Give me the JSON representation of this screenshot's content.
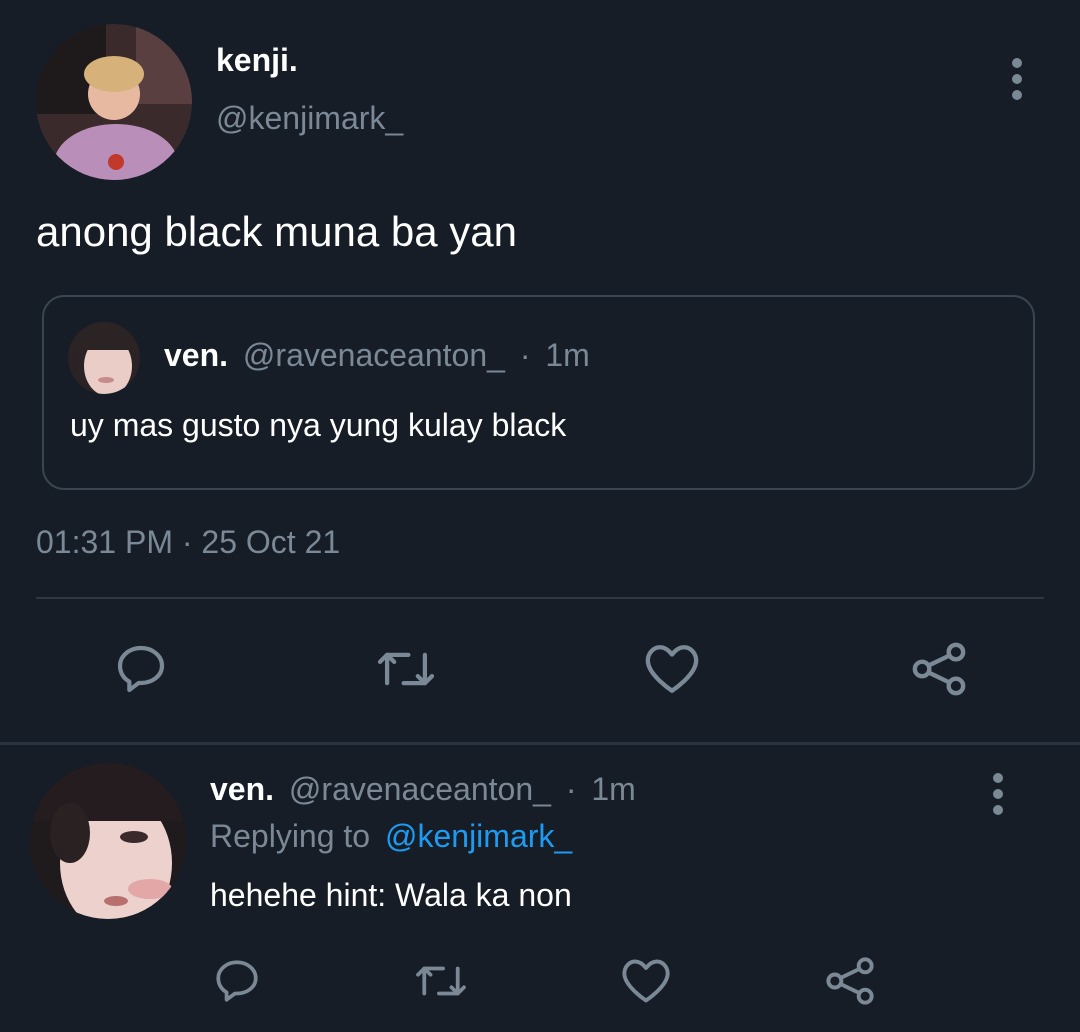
{
  "tweet": {
    "author_name": "kenji.",
    "author_handle": "@kenjimark_",
    "text": "anong black muna ba yan",
    "timestamp": "01:31 PM · 25 Oct 21",
    "quote": {
      "name": "ven.",
      "handle": "@ravenaceanton_",
      "sep": "·",
      "time": "1m",
      "text": "uy mas gusto nya yung kulay black"
    }
  },
  "reply": {
    "name": "ven.",
    "handle": "@ravenaceanton_",
    "sep": "·",
    "time": "1m",
    "replying_prefix": "Replying to",
    "replying_handle": "@kenjimark_",
    "text": "hehehe hint: Wala ka non"
  },
  "icons": [
    "reply-icon",
    "retweet-icon",
    "like-icon",
    "share-icon",
    "more-icon"
  ],
  "colors": {
    "background": "#161d27",
    "muted": "#7b8896",
    "link": "#1d9bf0",
    "divider": "#2f3945"
  }
}
